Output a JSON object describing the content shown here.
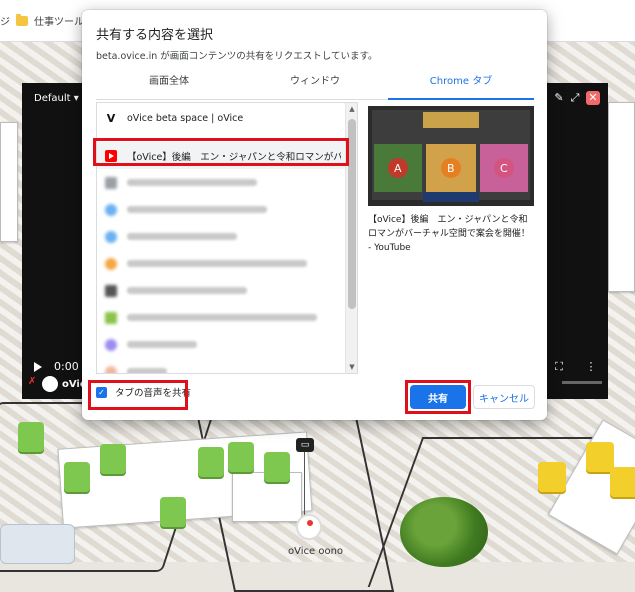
{
  "bookmarks": {
    "items": [
      {
        "label": "ジ"
      },
      {
        "label": "仕事ツール"
      }
    ]
  },
  "video_panel": {
    "quality_label": "Default",
    "time": "0:00",
    "room_label": "oVice"
  },
  "dialog": {
    "title": "共有する内容を選択",
    "subtitle": "beta.ovice.in が画面コンテンツの共有をリクエストしています。",
    "tabs": [
      {
        "label": "画面全体",
        "active": false
      },
      {
        "label": "ウィンドウ",
        "active": false
      },
      {
        "label": "Chrome タブ",
        "active": true
      }
    ],
    "list": [
      {
        "label": "oVice beta space | oVice",
        "icon": "ovice-v-icon",
        "blurred": false
      },
      {
        "label": "【oVice】後編　エン・ジャパンと令和ロマンがバーチャル空間…",
        "icon": "youtube-icon",
        "blurred": false,
        "selected": true
      }
    ],
    "preview_caption": "【oVice】後編　エン・ジャパンと令和ロマンがバーチャル空間で案会を開催！ - YouTube",
    "share_audio_label": "タブの音声を共有",
    "share_audio_checked": true,
    "share_button": "共有",
    "cancel_button": "キャンセル"
  },
  "space": {
    "user_name": "oVice oono"
  },
  "colors": {
    "accent": "#1a73e8",
    "highlight_frame": "#e0101b",
    "youtube_red": "#ff0000"
  }
}
